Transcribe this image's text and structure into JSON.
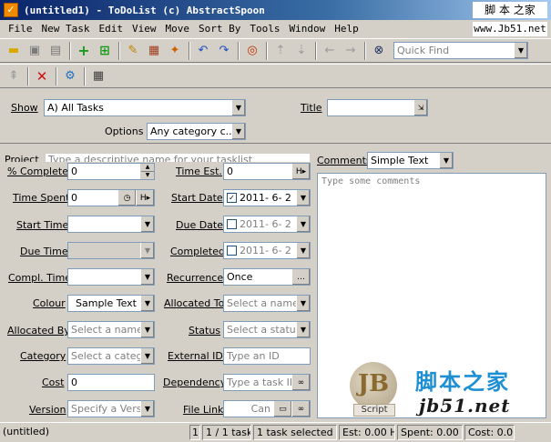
{
  "window": {
    "title": "(untitled1) - ToDoList (c) AbstractSpoon",
    "watermark_top": "脚 本 之家",
    "site_label": "www.Jb51.net"
  },
  "menu": [
    "File",
    "New Task",
    "Edit",
    "View",
    "Move",
    "Sort By",
    "Tools",
    "Window",
    "Help"
  ],
  "toolbar": {
    "quickfind_placeholder": "Quick Find"
  },
  "filter": {
    "show_label": "Show",
    "show_value": "A)  All Tasks",
    "title_label": "Title",
    "options_label": "Options",
    "options_value": "Any category c..."
  },
  "project_strip": {
    "label": "Project",
    "placeholder": "Type a descriptive name for your tasklist"
  },
  "fields": {
    "percent_complete": {
      "label": "% Complete",
      "value": "0"
    },
    "time_spent": {
      "label": "Time Spent",
      "value": "0",
      "units": "H"
    },
    "start_time": {
      "label": "Start Time"
    },
    "due_time": {
      "label": "Due Time"
    },
    "compl_time": {
      "label": "Compl. Time"
    },
    "colour": {
      "label": "Colour",
      "value": "Sample Text"
    },
    "allocated_by": {
      "label": "Allocated By",
      "placeholder": "Select a name"
    },
    "category": {
      "label": "Category",
      "placeholder": "Select a categ"
    },
    "cost": {
      "label": "Cost",
      "value": "0"
    },
    "version": {
      "label": "Version",
      "placeholder": "Specify a Versi"
    },
    "time_est": {
      "label": "Time Est.",
      "value": "0",
      "units": "H"
    },
    "start_date": {
      "label": "Start Date",
      "value": "2011- 6- 2"
    },
    "due_date": {
      "label": "Due Date",
      "value": "2011- 6- 2"
    },
    "completed": {
      "label": "Completed",
      "value": "2011- 6- 2"
    },
    "recurrence": {
      "label": "Recurrence",
      "value": "Once"
    },
    "allocated_to": {
      "label": "Allocated To",
      "placeholder": "Select a name"
    },
    "status": {
      "label": "Status",
      "placeholder": "Select a status"
    },
    "external_id": {
      "label": "External ID",
      "placeholder": "Type an ID"
    },
    "dependency": {
      "label": "Dependency",
      "placeholder": "Type a task II"
    },
    "file_link": {
      "label": "File Link",
      "placeholder": "Can"
    }
  },
  "comments": {
    "label": "Comments",
    "format": "Simple Text",
    "placeholder": "Type some comments"
  },
  "logo": {
    "mark": "JB",
    "script": "Script",
    "cn": "脚本之家",
    "net": "jb51.net"
  },
  "status": {
    "file": "(untitled)",
    "count": "1",
    "tasks": "1 / 1 tasks",
    "selected": "1 task selected (1)",
    "est": "Est: 0.00 H",
    "spent": "Spent: 0.00 H",
    "cost": "Cost: 0.0("
  },
  "colors": {
    "title_bar_start": "#0a246a",
    "face": "#d4d0c8",
    "field_border": "#7f9db9",
    "logo_blue": "#1d8fd2"
  }
}
